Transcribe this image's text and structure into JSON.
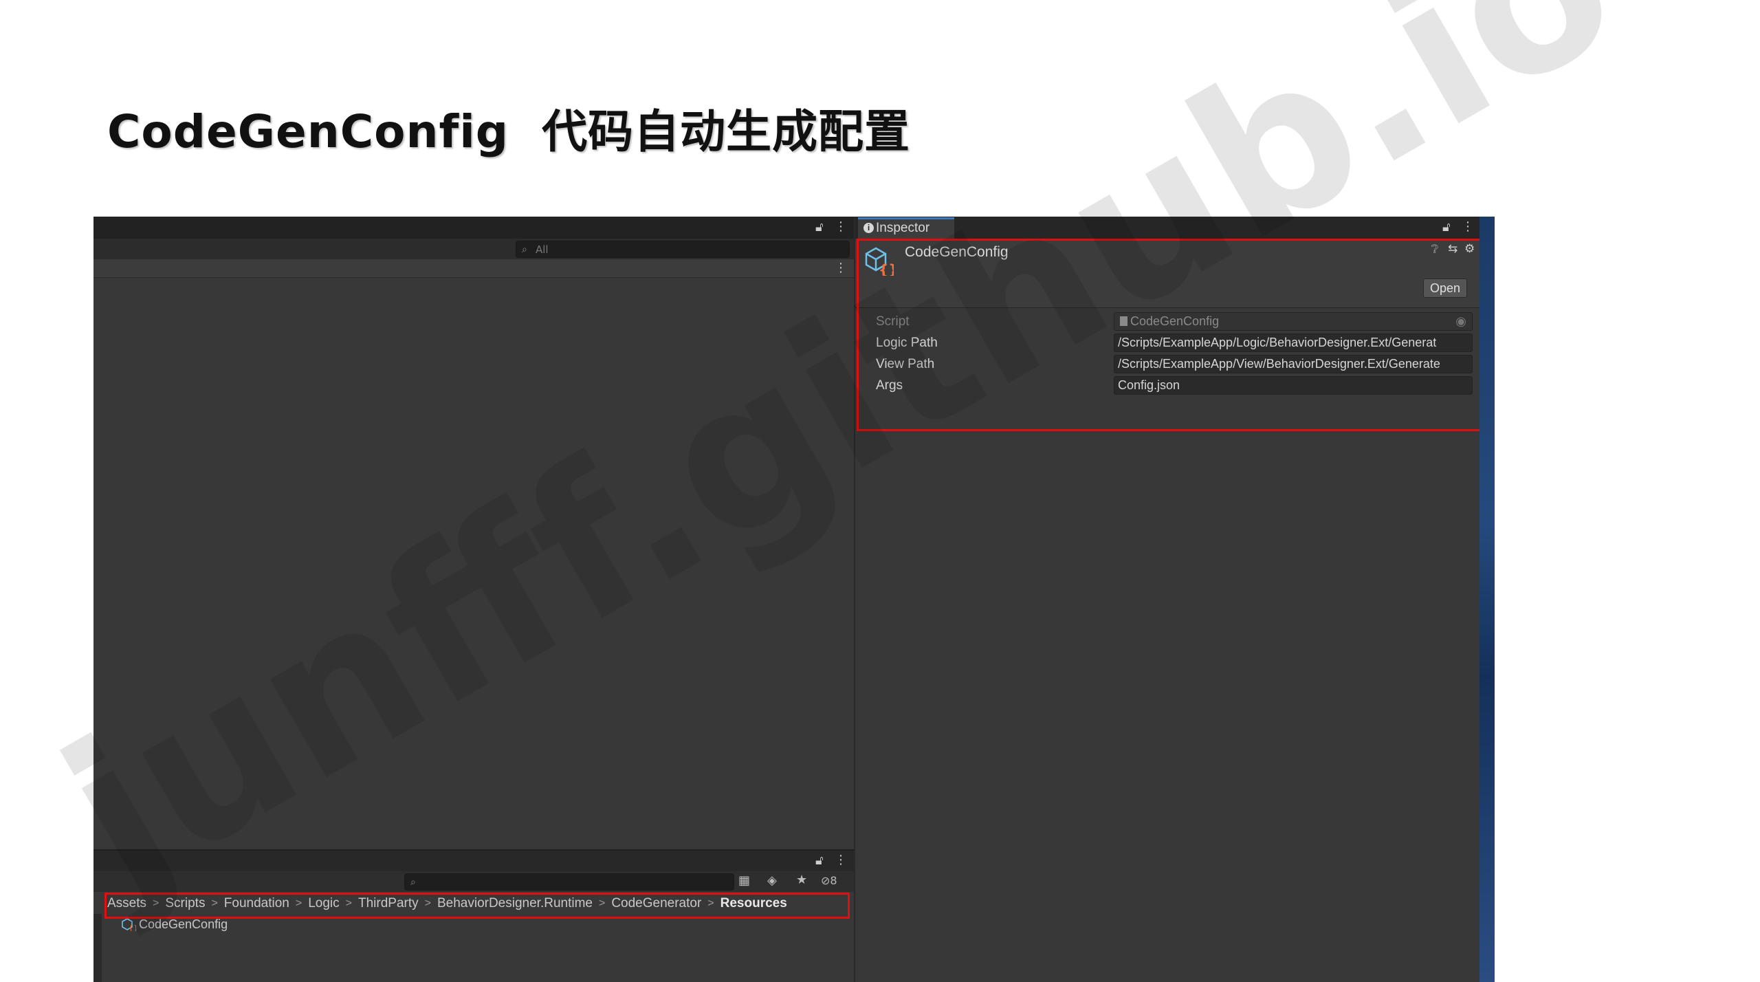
{
  "slide": {
    "title_en": "CodeGenConfig",
    "title_zh": "代码自动生成配置",
    "watermark": "junfff.github.io"
  },
  "hierarchy": {
    "search_placeholder": "All"
  },
  "project": {
    "breadcrumb": [
      "Assets",
      "Scripts",
      "Foundation",
      "Logic",
      "ThirdParty",
      "BehaviorDesigner.Runtime",
      "CodeGenerator",
      "Resources"
    ],
    "file_name": "CodeGenConfig",
    "hidden_count": "8"
  },
  "inspector": {
    "tab_label": "Inspector",
    "object_name": "CodeGenConfig",
    "open_label": "Open",
    "properties": [
      {
        "label": "Script",
        "value": "CodeGenConfig"
      },
      {
        "label": "Logic Path",
        "value": "/Scripts/ExampleApp/Logic/BehaviorDesigner.Ext/Generat"
      },
      {
        "label": "View Path",
        "value": "/Scripts/ExampleApp/View/BehaviorDesigner.Ext/Generate"
      },
      {
        "label": "Args",
        "value": "Config.json"
      }
    ]
  },
  "colors": {
    "highlight": "#e01010",
    "panel": "#383838",
    "tab_accent": "#3a79bb"
  }
}
